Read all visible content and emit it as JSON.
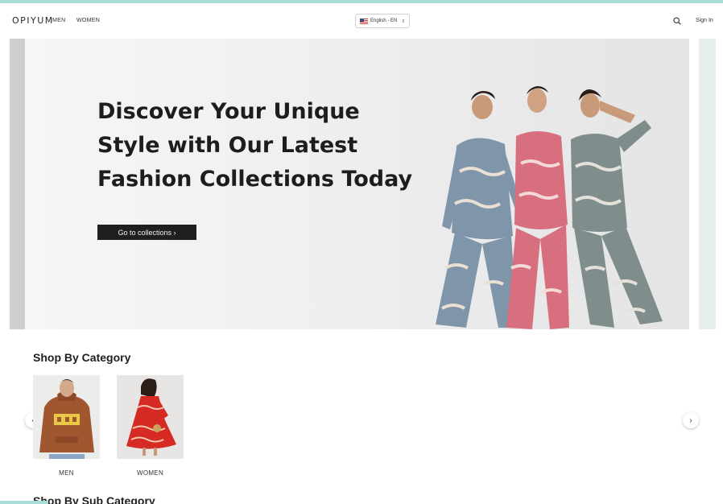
{
  "header": {
    "logo": "OPIYUM",
    "nav": [
      "MEN",
      "WOMEN"
    ],
    "language": "English - EN",
    "signin": "Sign In"
  },
  "hero": {
    "headline_lines": [
      "Discover Your Unique",
      "Style with Our Latest",
      "Fashion Collections Today"
    ],
    "cta": "Go to collections ›",
    "active_slide": 2,
    "slide_count": 3
  },
  "category_section": {
    "title": "Shop By Category",
    "items": [
      {
        "label": "MEN"
      },
      {
        "label": "WOMEN"
      }
    ]
  },
  "subcategory_section": {
    "title": "Shop By Sub Category"
  },
  "colors": {
    "accent": "#a8dcd6",
    "cta_bg": "#1f1f1f",
    "active_dot": "#2d7dd2"
  },
  "icons": [
    "search-icon",
    "chevron-left-icon",
    "chevron-right-icon",
    "us-flag-icon",
    "updown-icon"
  ]
}
